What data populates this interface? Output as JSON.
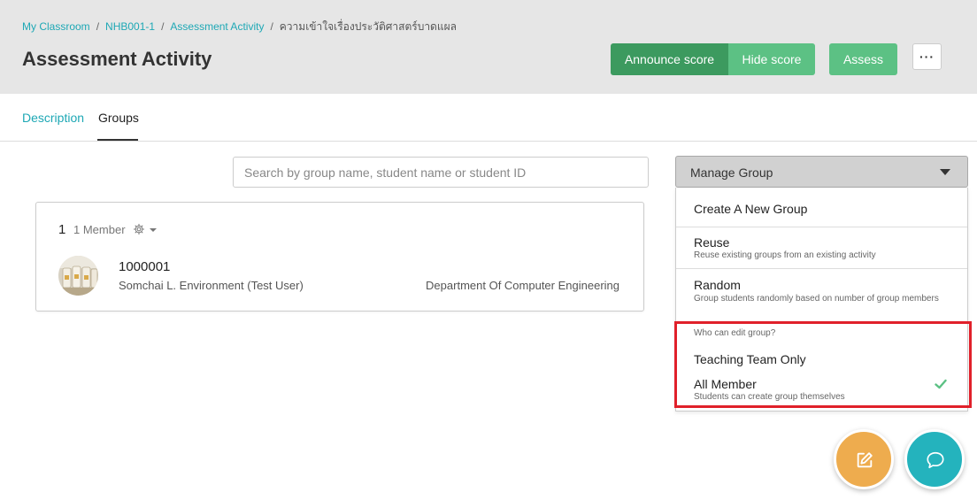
{
  "breadcrumb": {
    "items": [
      "My Classroom",
      "NHB001-1",
      "Assessment Activity"
    ],
    "current": "ความเข้าใจเรื่องประวัติศาสตร์บาดแผล"
  },
  "header": {
    "title": "Assessment Activity",
    "announce_label": "Announce score",
    "hide_label": "Hide score",
    "assess_label": "Assess",
    "more_label": "···"
  },
  "tabs": [
    {
      "label": "Description",
      "active": false
    },
    {
      "label": "Groups",
      "active": true
    }
  ],
  "search": {
    "placeholder": "Search by group name, student name or student ID",
    "value": ""
  },
  "manage": {
    "label": "Manage Group",
    "menu": {
      "create": "Create A New Group",
      "reuse": {
        "title": "Reuse",
        "sub": "Reuse existing groups from an existing activity"
      },
      "random": {
        "title": "Random",
        "sub": "Group students randomly based on number of group members"
      },
      "section_label": "Who can edit group?",
      "teaching_team": "Teaching Team Only",
      "all_member": {
        "title": "All Member",
        "sub": "Students can create group themselves",
        "selected": true
      }
    }
  },
  "group": {
    "number": "1",
    "member_count": "1 Member",
    "student": {
      "id": "1000001",
      "name": "Somchai L. Environment (Test User)",
      "department": "Department Of Computer Engineering"
    }
  },
  "colors": {
    "accent": "#1ea8b5",
    "green_dark": "#3c9a5f",
    "green": "#5cc184",
    "highlight": "#e0202a",
    "fab_edit": "#eeac4e",
    "fab_chat": "#24b3bd"
  },
  "icons": [
    "gear-icon",
    "caret-down-icon",
    "check-icon",
    "edit-icon",
    "chat-icon"
  ]
}
